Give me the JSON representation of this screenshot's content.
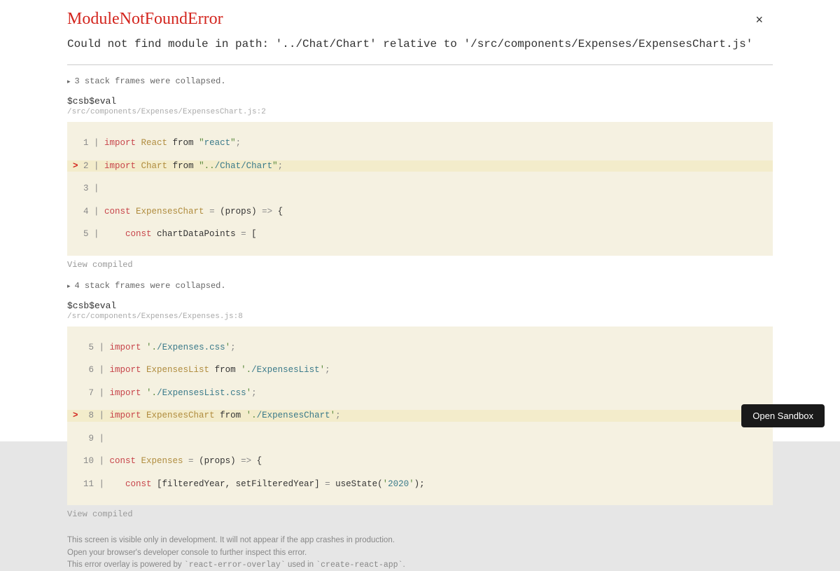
{
  "title": "ModuleNotFoundError",
  "message": "Could not find module in path: '../Chat/Chart' relative to '/src/components/Expenses/ExpensesChart.js'",
  "close_icon": "×",
  "collapsed1": "3 stack frames were collapsed.",
  "collapsed2": "4 stack frames were collapsed.",
  "frame1": {
    "name": "$csb$eval",
    "location": "/src/components/Expenses/ExpensesChart.js:2"
  },
  "frame2": {
    "name": "$csb$eval",
    "location": "/src/components/Expenses/Expenses.js:8"
  },
  "code1": {
    "l1_num": "  1 | ",
    "l1_import": "import",
    "l1_react": " React ",
    "l1_from": "from ",
    "l1_q1": "\"",
    "l1_str": "react",
    "l1_q2": "\"",
    "l1_semi": ";",
    "l2_marker": ">",
    "l2_num": " 2 | ",
    "l2_import": "import",
    "l2_chart": " Chart ",
    "l2_from": "from ",
    "l2_q1": "\"",
    "l2_dots": "..",
    "l2_path": "/Chat/Chart",
    "l2_q2": "\"",
    "l2_semi": ";",
    "l3_num": "  3 | ",
    "l4_num": "  4 | ",
    "l4_const": "const",
    "l4_name": " ExpensesChart ",
    "l4_eq": "=",
    "l4_props": " (props) ",
    "l4_arrow": "=>",
    "l4_brace": " {",
    "l5_num": "  5 | ",
    "l5_pad": "    ",
    "l5_const": "const",
    "l5_name": " chartDataPoints ",
    "l5_eq": "=",
    "l5_brack": " ["
  },
  "code2": {
    "l5_num": "   5 | ",
    "l5_import": "import",
    "l5_q1": " '",
    "l5_dot": ".",
    "l5_path": "/Expenses.css",
    "l5_q2": "'",
    "l5_semi": ";",
    "l6_num": "   6 | ",
    "l6_import": "import",
    "l6_name": " ExpensesList ",
    "l6_from": "from ",
    "l6_q1": "'",
    "l6_dot": ".",
    "l6_path": "/ExpensesList",
    "l6_q2": "'",
    "l6_semi": ";",
    "l7_num": "   7 | ",
    "l7_import": "import",
    "l7_q1": " '",
    "l7_dot": ".",
    "l7_path": "/ExpensesList.css",
    "l7_q2": "'",
    "l7_semi": ";",
    "l8_marker": ">",
    "l8_num": "  8 | ",
    "l8_import": "import",
    "l8_name": " ExpensesChart ",
    "l8_from": "from ",
    "l8_q1": "'",
    "l8_dot": ".",
    "l8_path": "/ExpensesChart",
    "l8_q2": "'",
    "l8_semi": ";",
    "l9_num": "   9 | ",
    "l10_num": "  10 | ",
    "l10_const": "const",
    "l10_name": " Expenses ",
    "l10_eq": "=",
    "l10_props": " (props) ",
    "l10_arrow": "=>",
    "l10_brace": " {",
    "l11_num": "  11 | ",
    "l11_pad": "   ",
    "l11_const": "const",
    "l11_destruct": " [filteredYear, setFilteredYear] ",
    "l11_eq": "=",
    "l11_use": " useState(",
    "l11_q1": "'",
    "l11_year": "2020",
    "l11_q2": "'",
    "l11_end": ");"
  },
  "view_compiled": "View compiled",
  "footer": {
    "line1": "This screen is visible only in development. It will not appear if the app crashes in production.",
    "line2": "Open your browser's developer console to further inspect this error.",
    "line3a": "This error overlay is powered by ",
    "line3b": "`react-error-overlay`",
    "line3c": " used in ",
    "line3d": "`create-react-app`",
    "line3e": "."
  },
  "sandbox_button": "Open Sandbox"
}
